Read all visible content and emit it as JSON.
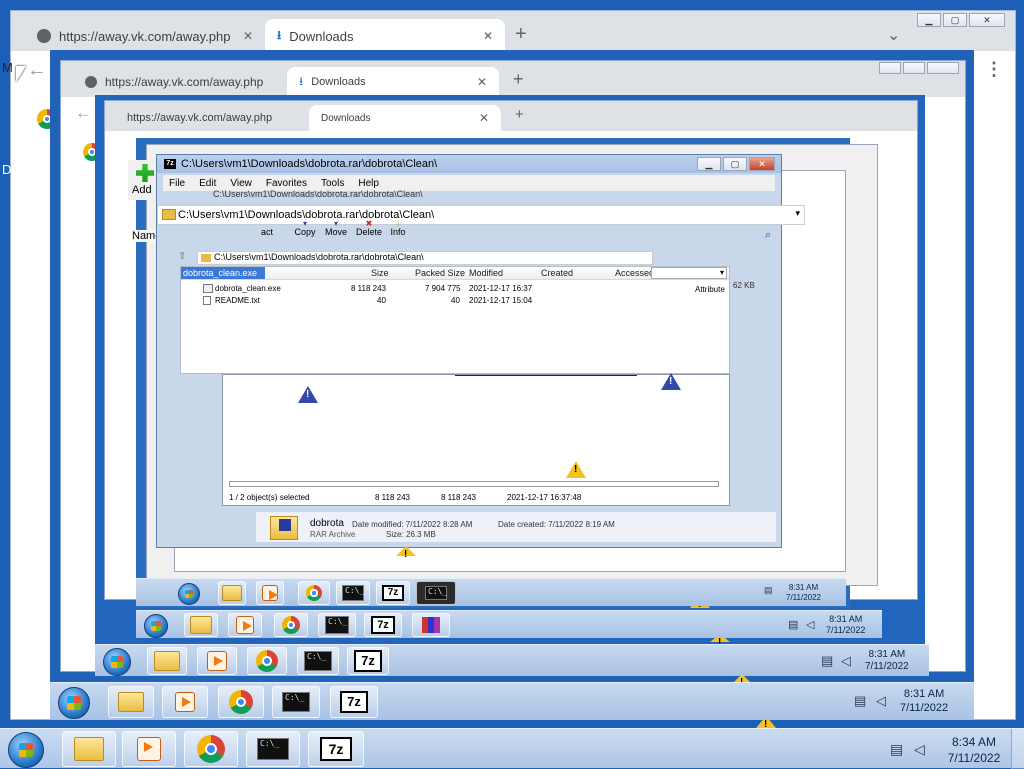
{
  "browser": {
    "tab1_title": "https://away.vk.com/away.php",
    "tab2_title": "Downloads",
    "new_tab": "+",
    "back": "←",
    "menu": "⋮",
    "close_tab": "✕",
    "tab_list": "⌄"
  },
  "sevenzip": {
    "title": "C:\\Users\\vm1\\Downloads\\dobrota.rar\\dobrota\\Clean\\",
    "address": "C:\\Users\\vm1\\Downloads\\dobrota.rar\\dobrota\\Clean\\",
    "inner_address": "C:\\Users\\vm1\\Downloads\\dobrota.rar\\dobrota\\Clean\\",
    "menu": [
      "File",
      "Edit",
      "View",
      "Favorites",
      "Tools",
      "Help"
    ],
    "toolbar": {
      "add": "Add",
      "extract": "act",
      "copy": "Copy",
      "move": "Move",
      "delete": "Delete",
      "info": "Info"
    },
    "name_column": "Name",
    "columns": [
      "Size",
      "Packed Size",
      "Modified",
      "Created",
      "Accessed"
    ],
    "attributes_col": "Attribute",
    "selected_rename": "dobrota_clean.exe",
    "size_fragment": "62 KB",
    "files": [
      {
        "name": "dobrota_clean.exe",
        "size": "8 118 243",
        "packed": "7 904 775",
        "modified": "2021-12-17 16:37"
      },
      {
        "name": "README.txt",
        "size": "40",
        "packed": "40",
        "modified": "2021-12-17 15:04"
      }
    ],
    "status": {
      "selected": "1 / 2 object(s) selected",
      "size": "8 118 243",
      "packed": "8 118 243",
      "date": "2021-12-17 16:37:48"
    }
  },
  "explorer_detail": {
    "name": "dobrota",
    "type": "RAR Archive",
    "modified": "Date modified: 7/11/2022 8:28 AM",
    "created": "Date created: 7/11/2022 8:19 AM",
    "size": "Size: 26.3 MB"
  },
  "taskbar": {
    "time": "8:34 AM",
    "date": "7/11/2022",
    "time_old": "8:31 AM",
    "date_old": "7/11/2022",
    "cmd_glyph": "C:\\_",
    "sz_glyph": "7z"
  },
  "edge_text": {
    "left_m": "M",
    "left_d": "D"
  }
}
